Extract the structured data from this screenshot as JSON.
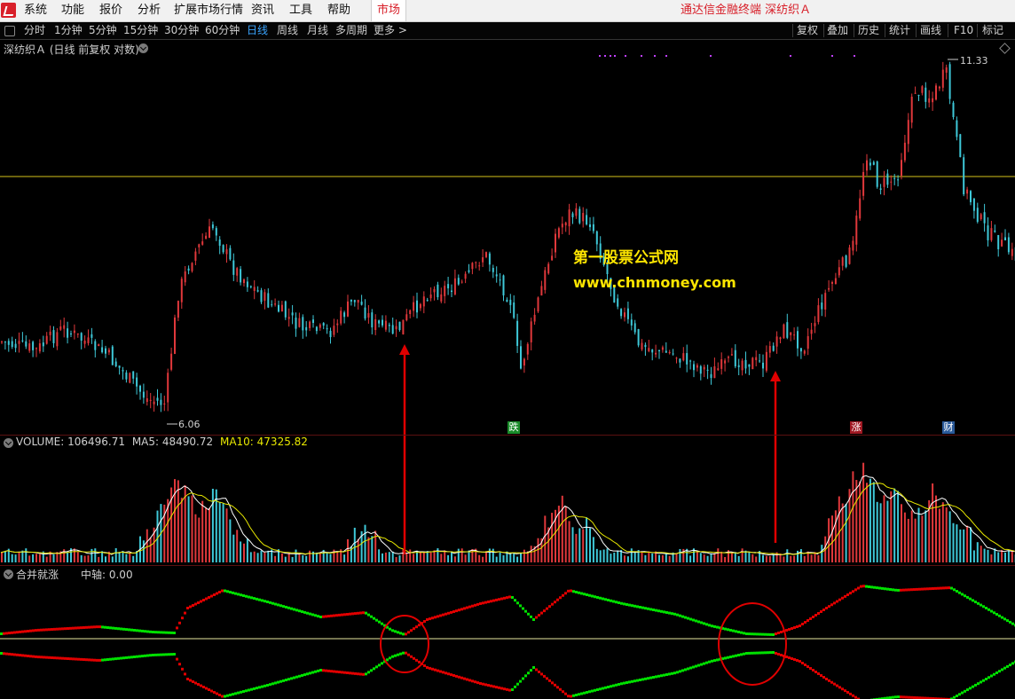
{
  "menubar": {
    "items": [
      "系统",
      "功能",
      "报价",
      "分析",
      "扩展市场行情",
      "资讯",
      "工具",
      "帮助"
    ],
    "market_tab": "市场",
    "window_title": "通达信金融终端  深纺织Ａ"
  },
  "toolbar": {
    "periods": [
      "分时",
      "1分钟",
      "5分钟",
      "15分钟",
      "30分钟",
      "60分钟",
      "日线",
      "周线",
      "月线",
      "多周期",
      "更多 >"
    ],
    "active_period": "日线",
    "tools": [
      "复权",
      "叠加",
      "历史",
      "统计",
      "画线",
      "F10",
      "标记"
    ]
  },
  "main_chart": {
    "title": "深纺织Ａ (日线 前复权 对数)",
    "high_label": "11.33",
    "low_label": "6.06",
    "markers": [
      {
        "text": "跌",
        "color": "#1a8c2a"
      },
      {
        "text": "涨",
        "color": "#a01822"
      },
      {
        "text": "财",
        "color": "#2a5a9a"
      }
    ],
    "watermark_title": "第一股票公式网",
    "watermark_url": "www.chnmoney.com",
    "colors": {
      "up": "#e0383b",
      "down": "#3ec8d8",
      "ref_line": "#d4c21a",
      "arrow": "#e00000"
    }
  },
  "volume_pane": {
    "label_volume": "VOLUME: 106496.71",
    "label_ma5": "MA5: 48490.72",
    "label_ma10": "MA10: 47325.82",
    "colors": {
      "ma5": "#ffffff",
      "ma10": "#e8e800"
    }
  },
  "indicator_pane": {
    "name": "合并就涨",
    "axis_label": "中轴: 0.00",
    "colors": {
      "rising": "#e00000",
      "falling": "#00e000",
      "axis": "#e8e8a0"
    }
  }
}
